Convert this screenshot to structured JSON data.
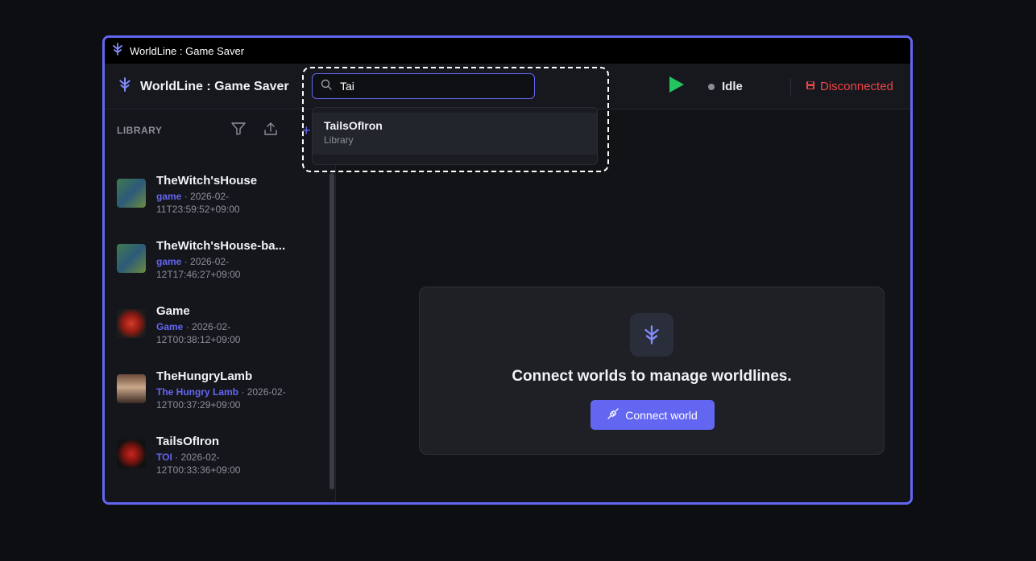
{
  "window": {
    "title": "WorldLine : Game Saver"
  },
  "header": {
    "brand": "WorldLine : Game Saver",
    "search": {
      "value": "Tai",
      "placeholder": ""
    },
    "status": "Idle",
    "connection": "Disconnected"
  },
  "search_results": [
    {
      "name": "TailsOfIron",
      "source": "Library"
    }
  ],
  "library": {
    "title": "LIBRARY",
    "items": [
      {
        "name": "TheWitch'sHouse",
        "type": "game",
        "date": "· 2026-02-11T23:59:52+09:00"
      },
      {
        "name": "TheWitch'sHouse-ba...",
        "type": "game",
        "date": "· 2026-02-12T17:46:27+09:00"
      },
      {
        "name": "Game",
        "type": "Game",
        "date": "· 2026-02-12T00:38:12+09:00"
      },
      {
        "name": "TheHungryLamb",
        "type": "The Hungry Lamb",
        "date": "· 2026-02-12T00:37:29+09:00"
      },
      {
        "name": "TailsOfIron",
        "type": "TOI",
        "date": "· 2026-02-12T00:33:36+09:00"
      }
    ]
  },
  "empty_state": {
    "message": "Connect worlds to manage worldlines.",
    "button": "Connect world"
  },
  "colors": {
    "accent": "#6366f1",
    "danger": "#ef4444",
    "play": "#22c55e"
  }
}
